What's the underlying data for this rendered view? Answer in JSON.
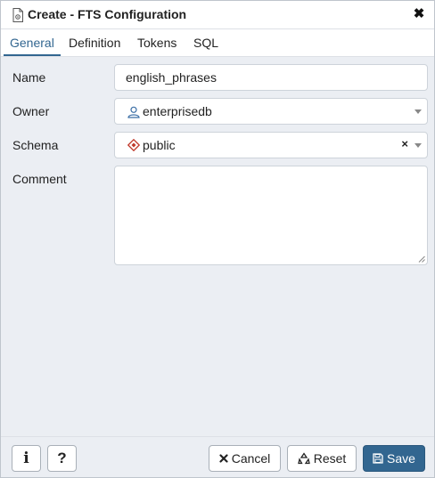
{
  "dialog": {
    "title": "Create - FTS Configuration",
    "close_symbol": "✖"
  },
  "tabs": [
    {
      "label": "General",
      "active": true
    },
    {
      "label": "Definition",
      "active": false
    },
    {
      "label": "Tokens",
      "active": false
    },
    {
      "label": "SQL",
      "active": false
    }
  ],
  "form": {
    "name": {
      "label": "Name",
      "value": "english_phrases"
    },
    "owner": {
      "label": "Owner",
      "value": "enterprisedb",
      "icon": "user-icon"
    },
    "schema": {
      "label": "Schema",
      "value": "public",
      "icon": "schema-icon",
      "clear_symbol": "×"
    },
    "comment": {
      "label": "Comment",
      "value": ""
    }
  },
  "footer": {
    "info_symbol": "i",
    "help_symbol": "?",
    "cancel_label": "Cancel",
    "reset_label": "Reset",
    "save_label": "Save"
  },
  "colors": {
    "accent": "#326690",
    "background": "#ebeef3",
    "schema_icon": "#c0392b"
  }
}
